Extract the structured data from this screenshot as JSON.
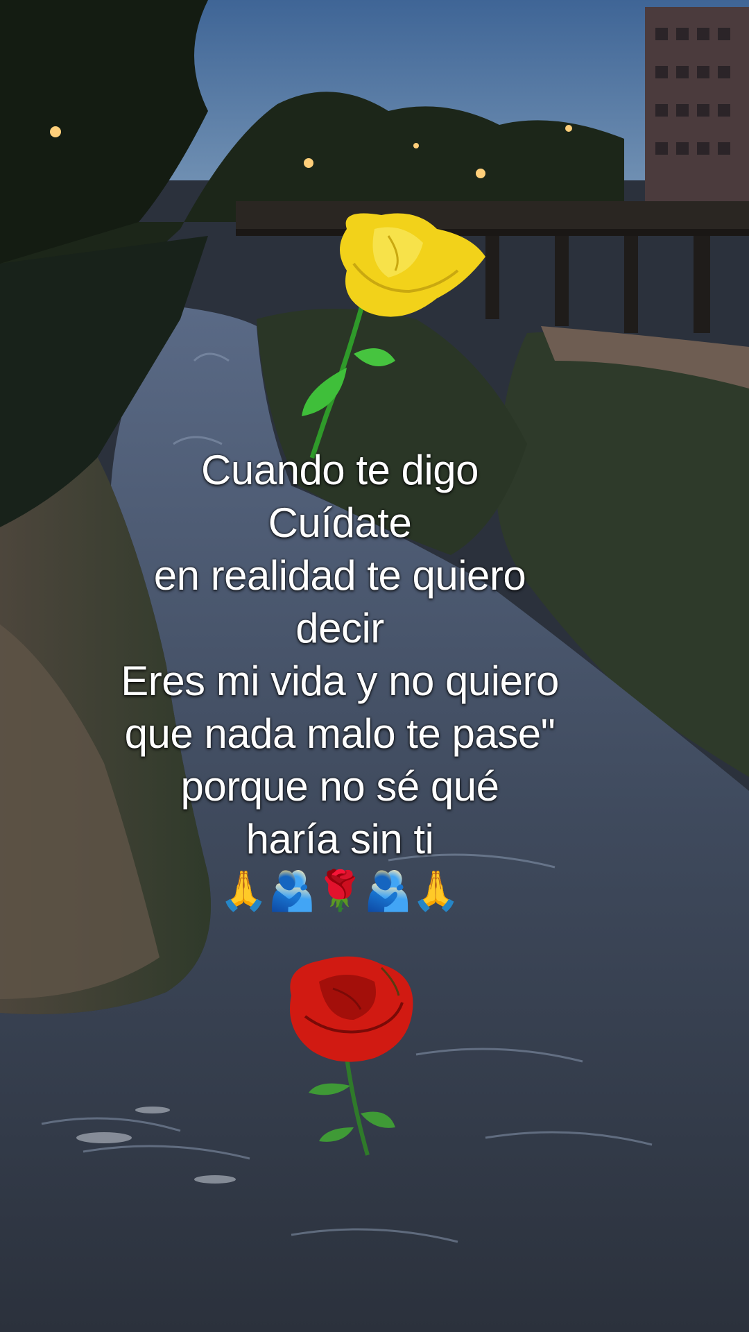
{
  "caption": {
    "lines": [
      "Cuando te digo",
      "Cuídate",
      "en realidad te quiero",
      "decir",
      "Eres mi vida y no quiero",
      "que nada malo te pase\"",
      "porque no sé qué",
      "haría sin ti"
    ],
    "emojis": "🙏🫂🌹🫂🙏"
  },
  "icons": {
    "top": "yellow-rose-icon",
    "bottom": "red-rose-icon"
  },
  "colors": {
    "sky": "#4f6f9a",
    "water": "#3a4252",
    "foliage": "#1f2a1c",
    "caption_text": "#ffffff",
    "rose_yellow": "#f2d21a",
    "rose_red": "#d11a12"
  }
}
